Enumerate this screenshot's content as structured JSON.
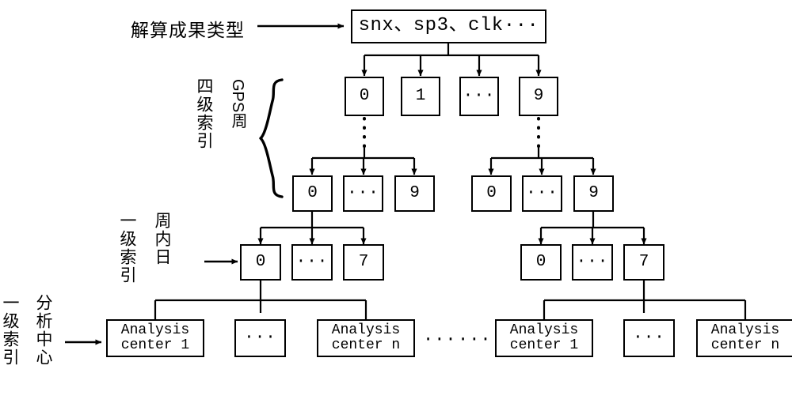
{
  "diagram": {
    "title_label": "解算成果类型",
    "levels": {
      "four_level_index": "四级索引",
      "gps_week": "GPS周",
      "level_one_index_day": "一级索引",
      "day_of_week": "周内日",
      "level_one_index_ac": "一级索引",
      "analysis_center": "分析中心"
    },
    "type_box": {
      "label": "snx、sp3、clk···"
    },
    "row1": [
      {
        "label": "0"
      },
      {
        "label": "1"
      },
      {
        "label": "···"
      },
      {
        "label": "9"
      }
    ],
    "row2_left": [
      {
        "label": "0"
      },
      {
        "label": "···"
      },
      {
        "label": "9"
      }
    ],
    "row2_right": [
      {
        "label": "0"
      },
      {
        "label": "···"
      },
      {
        "label": "9"
      }
    ],
    "row3_left": [
      {
        "label": "0"
      },
      {
        "label": "···"
      },
      {
        "label": "7"
      }
    ],
    "row3_right": [
      {
        "label": "0"
      },
      {
        "label": "···"
      },
      {
        "label": "7"
      }
    ],
    "row4_left": [
      {
        "label": "Analysis\ncenter 1"
      },
      {
        "label": "···"
      },
      {
        "label": "Analysis\ncenter n"
      }
    ],
    "row4_right": [
      {
        "label": "Analysis\ncenter 1"
      },
      {
        "label": "···"
      },
      {
        "label": "Analysis\ncenter n"
      }
    ],
    "separators": {
      "mid_left": "···",
      "mid_right": "···"
    },
    "colors": {
      "stroke": "#000000",
      "background": "#ffffff"
    }
  }
}
